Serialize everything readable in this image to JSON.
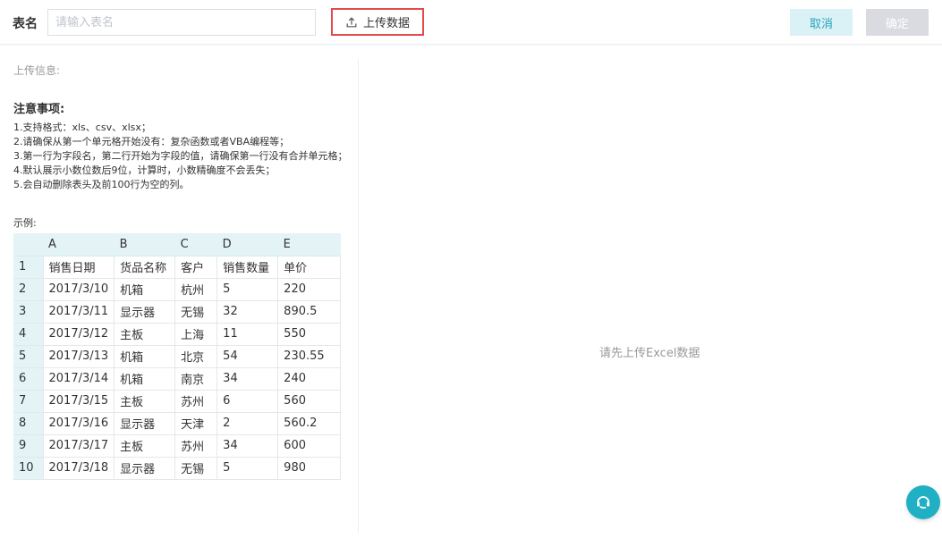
{
  "header": {
    "table_name_label": "表名",
    "table_name_placeholder": "请输入表名",
    "table_name_value": "",
    "upload_label": "上传数据",
    "cancel_label": "取消",
    "confirm_label": "确定"
  },
  "left_panel": {
    "upload_info_label": "上传信息:",
    "notice_title": "注意事项:",
    "notes": [
      "1.支持格式：xls、csv、xlsx；",
      "2.请确保从第一个单元格开始没有：复杂函数或者VBA编程等；",
      "3.第一行为字段名，第二行开始为字段的值，请确保第一行没有合并单元格；",
      "4.默认展示小数位数后9位，计算时，小数精确度不会丢失；",
      "5.会自动删除表头及前100行为空的列。"
    ],
    "example_label": "示例:",
    "sample_table": {
      "column_letters": [
        "",
        "A",
        "B",
        "C",
        "D",
        "E"
      ],
      "rows": [
        [
          "1",
          "销售日期",
          "货品名称",
          "客户",
          "销售数量",
          "单价"
        ],
        [
          "2",
          "2017/3/10",
          "机箱",
          "杭州",
          "5",
          "220"
        ],
        [
          "3",
          "2017/3/11",
          "显示器",
          "无锡",
          "32",
          "890.5"
        ],
        [
          "4",
          "2017/3/12",
          "主板",
          "上海",
          "11",
          "550"
        ],
        [
          "5",
          "2017/3/13",
          "机箱",
          "北京",
          "54",
          "230.55"
        ],
        [
          "6",
          "2017/3/14",
          "机箱",
          "南京",
          "34",
          "240"
        ],
        [
          "7",
          "2017/3/15",
          "主板",
          "苏州",
          "6",
          "560"
        ],
        [
          "8",
          "2017/3/16",
          "显示器",
          "天津",
          "2",
          "560.2"
        ],
        [
          "9",
          "2017/3/17",
          "主板",
          "苏州",
          "34",
          "600"
        ],
        [
          "10",
          "2017/3/18",
          "显示器",
          "无锡",
          "5",
          "980"
        ]
      ]
    }
  },
  "right_panel": {
    "empty_message": "请先上传Excel数据"
  },
  "icons": {
    "upload": "upload-icon",
    "chat": "chat-support-icon"
  },
  "colors": {
    "accent": "#1fb0c4",
    "cancel_bg": "#daf1f5",
    "cancel_text": "#2aa4bd",
    "confirm_bg_disabled": "#d9dbe1",
    "highlight_border": "#e24b4b",
    "table_header_bg": "#e3f3f6"
  }
}
